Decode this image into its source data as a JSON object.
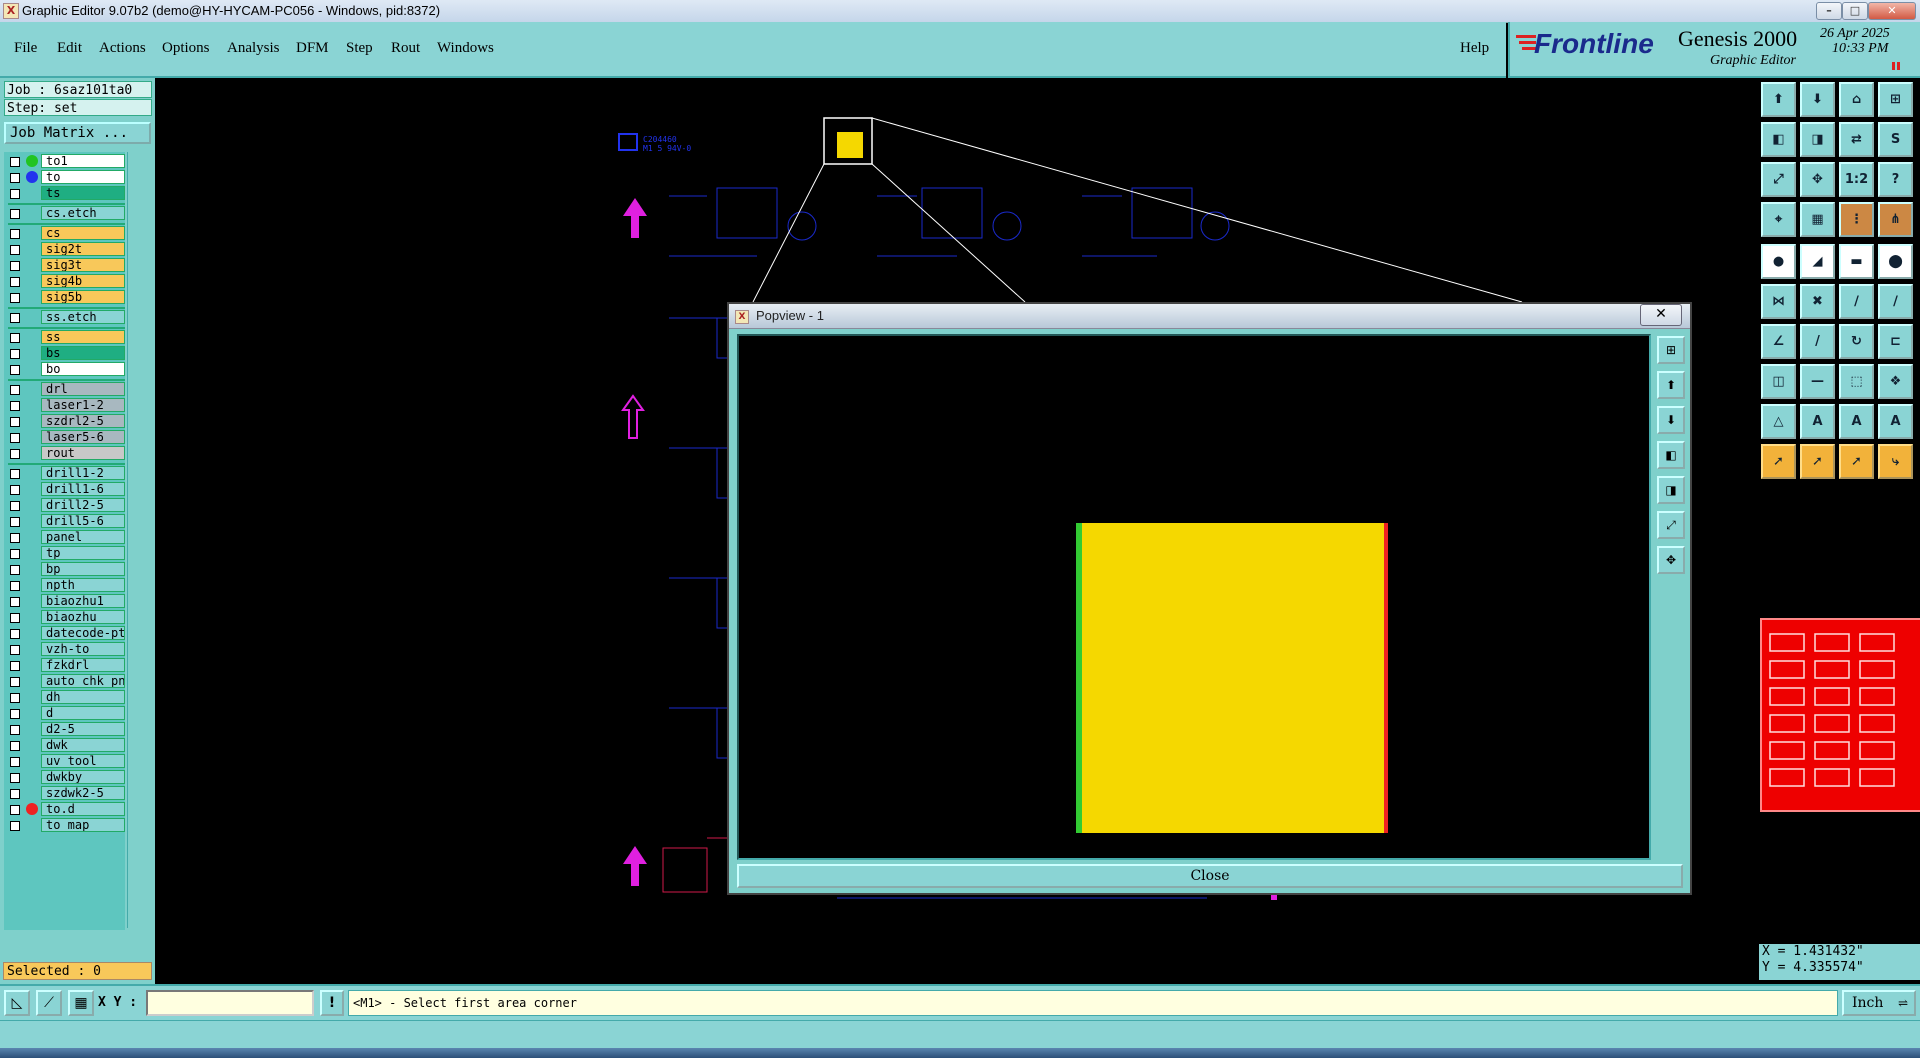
{
  "window": {
    "title": "Graphic Editor 9.07b2 (demo@HY-HYCAM-PC056 - Windows, pid:8372)",
    "icon_text": "X"
  },
  "menubar": {
    "items": [
      "File",
      "Edit",
      "Actions",
      "Options",
      "Analysis",
      "DFM",
      "Step",
      "Rout",
      "Windows"
    ],
    "help": "Help"
  },
  "brand": {
    "logo": "Frontline",
    "product": "Genesis 2000",
    "subtitle": "Graphic Editor",
    "date": "26 Apr 2025",
    "time": "10:33 PM"
  },
  "job": {
    "job_line": "Job : 6saz101ta0",
    "step_line": "Step: set",
    "matrix_button": "Job Matrix ..."
  },
  "layers": [
    {
      "name": "to1",
      "bg": "#ffffff",
      "dot": "#22c422"
    },
    {
      "name": "to",
      "bg": "#ffffff",
      "dot": "#2233ee"
    },
    {
      "name": "ts",
      "bg": "#1fae82",
      "dot": ""
    },
    {
      "name": "cs.etch",
      "bg": "#8ad4d4",
      "dot": ""
    },
    {
      "name": "cs",
      "bg": "#f8c85a",
      "dot": ""
    },
    {
      "name": "sig2t",
      "bg": "#f8c85a",
      "dot": ""
    },
    {
      "name": "sig3t",
      "bg": "#f8c85a",
      "dot": ""
    },
    {
      "name": "sig4b",
      "bg": "#f8c85a",
      "dot": ""
    },
    {
      "name": "sig5b",
      "bg": "#f8c85a",
      "dot": ""
    },
    {
      "name": "ss.etch",
      "bg": "#8ad4d4",
      "dot": ""
    },
    {
      "name": "ss",
      "bg": "#f8c85a",
      "dot": ""
    },
    {
      "name": "bs",
      "bg": "#1fae82",
      "dot": ""
    },
    {
      "name": "bo",
      "bg": "#ffffff",
      "dot": ""
    },
    {
      "name": "drl",
      "bg": "#a8b8c0",
      "dot": ""
    },
    {
      "name": "laser1-2",
      "bg": "#a8b8c0",
      "dot": ""
    },
    {
      "name": "szdrl2-5",
      "bg": "#a8b8c0",
      "dot": ""
    },
    {
      "name": "laser5-6",
      "bg": "#a8b8c0",
      "dot": ""
    },
    {
      "name": "rout",
      "bg": "#c8c8c8",
      "dot": ""
    },
    {
      "name": "drill1-2",
      "bg": "#8ad4d4",
      "dot": ""
    },
    {
      "name": "drill1-6",
      "bg": "#8ad4d4",
      "dot": ""
    },
    {
      "name": "drill2-5",
      "bg": "#8ad4d4",
      "dot": ""
    },
    {
      "name": "drill5-6",
      "bg": "#8ad4d4",
      "dot": ""
    },
    {
      "name": "panel",
      "bg": "#8ad4d4",
      "dot": ""
    },
    {
      "name": "tp",
      "bg": "#8ad4d4",
      "dot": ""
    },
    {
      "name": "bp",
      "bg": "#8ad4d4",
      "dot": ""
    },
    {
      "name": "npth",
      "bg": "#8ad4d4",
      "dot": ""
    },
    {
      "name": "biaozhu1",
      "bg": "#8ad4d4",
      "dot": ""
    },
    {
      "name": "biaozhu",
      "bg": "#8ad4d4",
      "dot": ""
    },
    {
      "name": "datecode-pt",
      "bg": "#8ad4d4",
      "dot": ""
    },
    {
      "name": "vzh-to",
      "bg": "#8ad4d4",
      "dot": ""
    },
    {
      "name": "fzkdrl",
      "bg": "#8ad4d4",
      "dot": ""
    },
    {
      "name": "auto_chk_pn",
      "bg": "#8ad4d4",
      "dot": ""
    },
    {
      "name": "dh",
      "bg": "#8ad4d4",
      "dot": ""
    },
    {
      "name": "d",
      "bg": "#8ad4d4",
      "dot": ""
    },
    {
      "name": "d2-5",
      "bg": "#8ad4d4",
      "dot": ""
    },
    {
      "name": "dwk",
      "bg": "#8ad4d4",
      "dot": ""
    },
    {
      "name": "uv_tool",
      "bg": "#8ad4d4",
      "dot": ""
    },
    {
      "name": "dwkby",
      "bg": "#8ad4d4",
      "dot": ""
    },
    {
      "name": "szdwk2-5",
      "bg": "#8ad4d4",
      "dot": ""
    },
    {
      "name": "to.d",
      "bg": "#8ad4d4",
      "dot": "#ee2222"
    },
    {
      "name": "to_map",
      "bg": "#8ad4d4",
      "dot": ""
    }
  ],
  "selected": "Selected : 0",
  "canvas": {
    "annotation": "C204460\nM1 5 94V-0"
  },
  "popview": {
    "title": "Popview - 1",
    "close_x": "✕",
    "close_button": "Close"
  },
  "status": {
    "xy_label": "X Y :",
    "xy_value": "",
    "excl": "!",
    "prompt": "<M1> - Select first area corner",
    "unit": "Inch"
  },
  "coords": {
    "x": "X = 1.431432\"",
    "y": "Y = 4.335574\""
  }
}
